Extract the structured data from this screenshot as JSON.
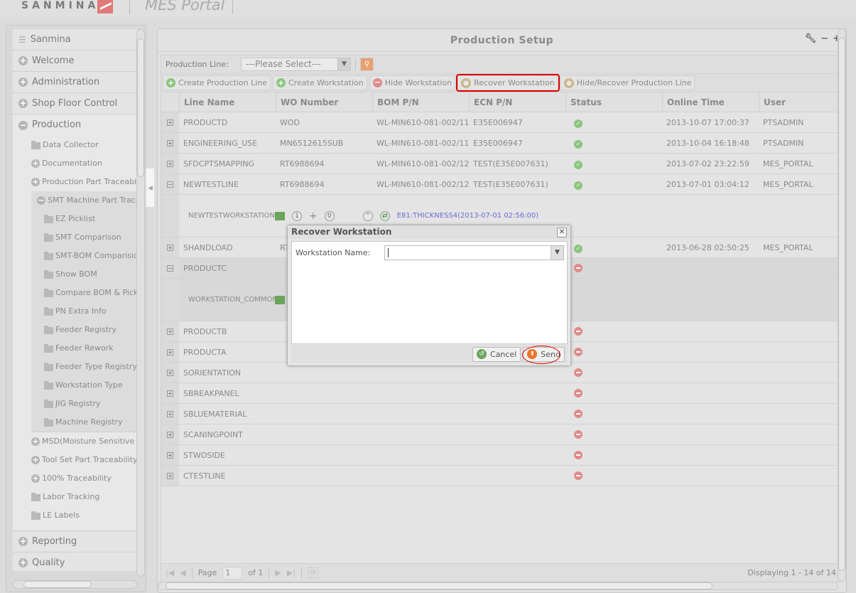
{
  "header": {
    "brand": "SANMINA",
    "portal_title": "MES Portal"
  },
  "sidebar": {
    "title": "Sanmina",
    "sections": [
      {
        "label": "Welcome",
        "expanded": false
      },
      {
        "label": "Administration",
        "expanded": false
      },
      {
        "label": "Shop Floor Control",
        "expanded": false
      },
      {
        "label": "Production",
        "expanded": true
      }
    ],
    "production_items": [
      {
        "label": "Data Collector",
        "icon": "folder-icon"
      },
      {
        "label": "Documentation",
        "icon": "plus-icon"
      },
      {
        "label": "Production Part Traceability",
        "icon": "plus-icon"
      }
    ],
    "smt_group": {
      "label": "SMT Machine Part Traceability",
      "items": [
        "EZ Picklist",
        "SMT Comparison",
        "SMT-BOM Comparision",
        "Show BOM",
        "Compare BOM & Picklist",
        "PN Extra Info",
        "Feeder Registry",
        "Feeder Rework",
        "Feeder Type Registry",
        "Workstation Type",
        "JIG Registry",
        "Machine Registry"
      ]
    },
    "production_items_after": [
      {
        "label": "MSD(Moisture Sensitive Devices)",
        "icon": "plus-icon"
      },
      {
        "label": "Tool Set Part Traceability",
        "icon": "plus-icon"
      },
      {
        "label": "100% Traceability",
        "icon": "plus-icon"
      },
      {
        "label": "Labor Tracking",
        "icon": "folder-icon"
      },
      {
        "label": "LE Labels",
        "icon": "folder-icon"
      }
    ],
    "sections_after": [
      {
        "label": "Reporting"
      },
      {
        "label": "Quality"
      }
    ]
  },
  "panel": {
    "title": "Production Setup",
    "tools": [
      "wrench-icon",
      "minimize",
      "maximize"
    ],
    "filter": {
      "label": "Production Line:",
      "value": "---Please Select---"
    },
    "toolbar": [
      {
        "label": "Create Production Line",
        "icon": "add-icon"
      },
      {
        "label": "Create Workstation",
        "icon": "add-icon"
      },
      {
        "label": "Hide Workstation",
        "icon": "remove-icon"
      },
      {
        "label": "Recover Workstation",
        "icon": "gear-icon",
        "highlighted": true
      },
      {
        "label": "Hide/Recover Production Line",
        "icon": "gear-icon"
      }
    ],
    "columns": [
      "Line Name",
      "WO Number",
      "BOM P/N",
      "ECN P/N",
      "Status",
      "Online Time",
      "User"
    ],
    "rows": [
      {
        "line": "PRODUCTD",
        "wo": "WOD",
        "bom": "WL-MIN610-081-002/11",
        "ecn": "E35E006947",
        "status": "ok",
        "time": "2013-10-07 17:00:37",
        "user": "PTSADMIN",
        "expanded": false
      },
      {
        "line": "ENGINEERING_USE",
        "wo": "MN6512615SUB",
        "bom": "WL-MIN610-081-002/11",
        "ecn": "E35E006947",
        "status": "ok",
        "time": "2013-10-04 16:18:48",
        "user": "PTSADMIN",
        "expanded": false
      },
      {
        "line": "SFDCPTSMAPPING",
        "wo": "RT6988694",
        "bom": "WL-MIN610-081-002/12",
        "ecn": "TEST(E35E007631)",
        "status": "ok",
        "time": "2013-07-02 23:22:59",
        "user": "MES_PORTAL",
        "expanded": false
      },
      {
        "line": "NEWTESTLINE",
        "wo": "RT6988694",
        "bom": "WL-MIN610-081-002/12",
        "ecn": "TEST(E35E007631)",
        "status": "ok",
        "time": "2013-07-01 03:04:12",
        "user": "MES_PORTAL",
        "expanded": true,
        "workstation": {
          "name": "NEWTESTWORKSTATION",
          "count_a": "1",
          "count_b": "0",
          "link": "E81:THICKNESS4(2013-07-01 02:56:00)"
        }
      },
      {
        "line": "SHANDLOAD",
        "wo": "RT",
        "bom": "",
        "ecn": "",
        "status": "ok",
        "time": "2013-06-28 02:50:25",
        "user": "MES_PORTAL",
        "expanded": false
      },
      {
        "line": "PRODUCTC",
        "wo": "",
        "bom": "",
        "ecn": "",
        "status": "hidden",
        "time": "",
        "user": "",
        "expanded": true,
        "workstation": {
          "name": "WORKSTATION_COMMON"
        }
      },
      {
        "line": "PRODUCTB",
        "wo": "",
        "bom": "",
        "ecn": "",
        "status": "hidden",
        "time": "",
        "user": "",
        "expanded": false
      },
      {
        "line": "PRODUCTA",
        "wo": "",
        "bom": "",
        "ecn": "",
        "status": "hidden",
        "time": "",
        "user": "",
        "expanded": false
      },
      {
        "line": "SORIENTATION",
        "wo": "",
        "bom": "",
        "ecn": "",
        "status": "hidden",
        "time": "",
        "user": "",
        "expanded": false
      },
      {
        "line": "SBREAKPANEL",
        "wo": "",
        "bom": "",
        "ecn": "",
        "status": "hidden",
        "time": "",
        "user": "",
        "expanded": false
      },
      {
        "line": "SBLUEMATERIAL",
        "wo": "",
        "bom": "",
        "ecn": "",
        "status": "hidden",
        "time": "",
        "user": "",
        "expanded": false
      },
      {
        "line": "SCANINGPOINT",
        "wo": "",
        "bom": "",
        "ecn": "",
        "status": "hidden",
        "time": "",
        "user": "",
        "expanded": false
      },
      {
        "line": "STWOSIDE",
        "wo": "",
        "bom": "",
        "ecn": "",
        "status": "hidden",
        "time": "",
        "user": "",
        "expanded": false
      },
      {
        "line": "CTESTLINE",
        "wo": "",
        "bom": "",
        "ecn": "",
        "status": "hidden",
        "time": "",
        "user": "",
        "expanded": false
      }
    ],
    "pager": {
      "page_label": "Page",
      "page_value": "1",
      "of_label": "of 1",
      "displaying": "Displaying 1 - 14 of 14"
    }
  },
  "dialog": {
    "title": "Recover Workstation",
    "field_label": "Workstation Name:",
    "field_value": "",
    "cancel_label": "Cancel",
    "send_label": "Send"
  },
  "colors": {
    "highlight": "#e00000",
    "ok_status": "#8cc57e",
    "hidden_status": "#e08b8b",
    "link": "#6b6bd6"
  }
}
